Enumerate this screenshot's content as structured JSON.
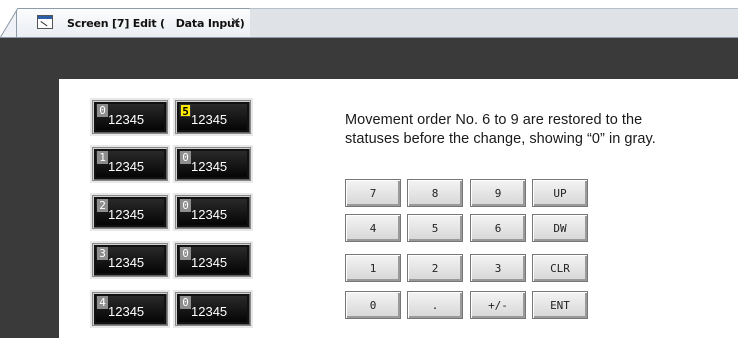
{
  "tab": {
    "title": "Screen [7] Edit (   Data Input)",
    "close_glyph": "×"
  },
  "grid": {
    "left_column": [
      {
        "badge": "0",
        "value": "12345"
      },
      {
        "badge": "1",
        "value": "12345"
      },
      {
        "badge": "2",
        "value": "12345"
      },
      {
        "badge": "3",
        "value": "12345"
      },
      {
        "badge": "4",
        "value": "12345"
      }
    ],
    "right_column": [
      {
        "badge": "5",
        "value": "12345",
        "highlight": true
      },
      {
        "badge": "0",
        "value": "12345"
      },
      {
        "badge": "0",
        "value": "12345"
      },
      {
        "badge": "0",
        "value": "12345"
      },
      {
        "badge": "0",
        "value": "12345"
      }
    ]
  },
  "description": {
    "line1": "Movement order No. 6 to 9 are restored to the",
    "line2": "statuses before the change, showing “0” in gray."
  },
  "keypad": {
    "rows": [
      [
        "7",
        "8",
        "9",
        "UP"
      ],
      [
        "4",
        "5",
        "6",
        "DW"
      ],
      [
        "1",
        "2",
        "3",
        "CLR"
      ],
      [
        "0",
        ".",
        "+/-",
        "ENT"
      ]
    ]
  },
  "colors": {
    "frame": "#3a3a3a",
    "badge_gray": "#8d8d8d",
    "badge_highlight": "#ffec00"
  }
}
